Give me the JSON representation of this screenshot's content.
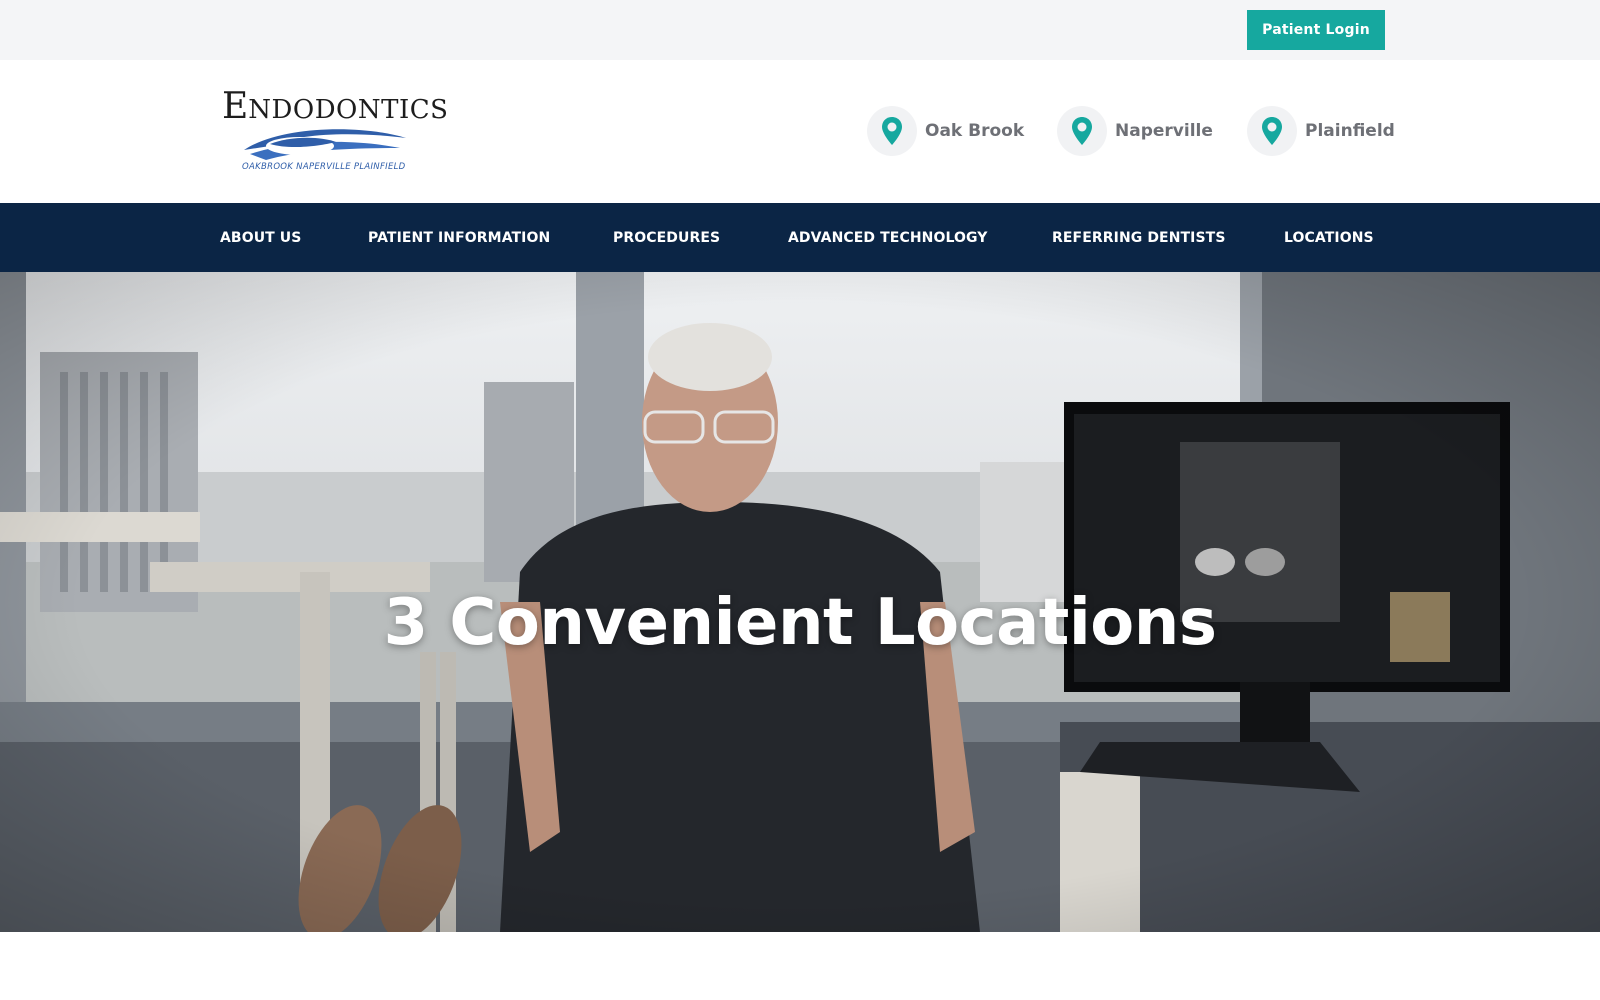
{
  "topbar": {
    "login_label": "Patient Login"
  },
  "header": {
    "logo": {
      "word_first": "E",
      "word_rest": "NDODONTICS",
      "subtitle": "OAKBROOK NAPERVILLE PLAINFIELD"
    },
    "locations": [
      {
        "label": "Oak Brook",
        "icon": "map-pin-icon"
      },
      {
        "label": "Naperville",
        "icon": "map-pin-icon"
      },
      {
        "label": "Plainfield",
        "icon": "map-pin-icon"
      }
    ]
  },
  "nav": {
    "items": [
      {
        "label": "ABOUT US"
      },
      {
        "label": "PATIENT INFORMATION"
      },
      {
        "label": "PROCEDURES"
      },
      {
        "label": "ADVANCED TECHNOLOGY"
      },
      {
        "label": "REFERRING DENTISTS"
      },
      {
        "label": "LOCATIONS"
      }
    ]
  },
  "hero": {
    "title": "3 Convenient Locations"
  },
  "colors": {
    "accent": "#16a89f",
    "nav_bg": "#0b2545",
    "topbar_bg": "#f4f5f7",
    "location_text": "#6e7076"
  }
}
